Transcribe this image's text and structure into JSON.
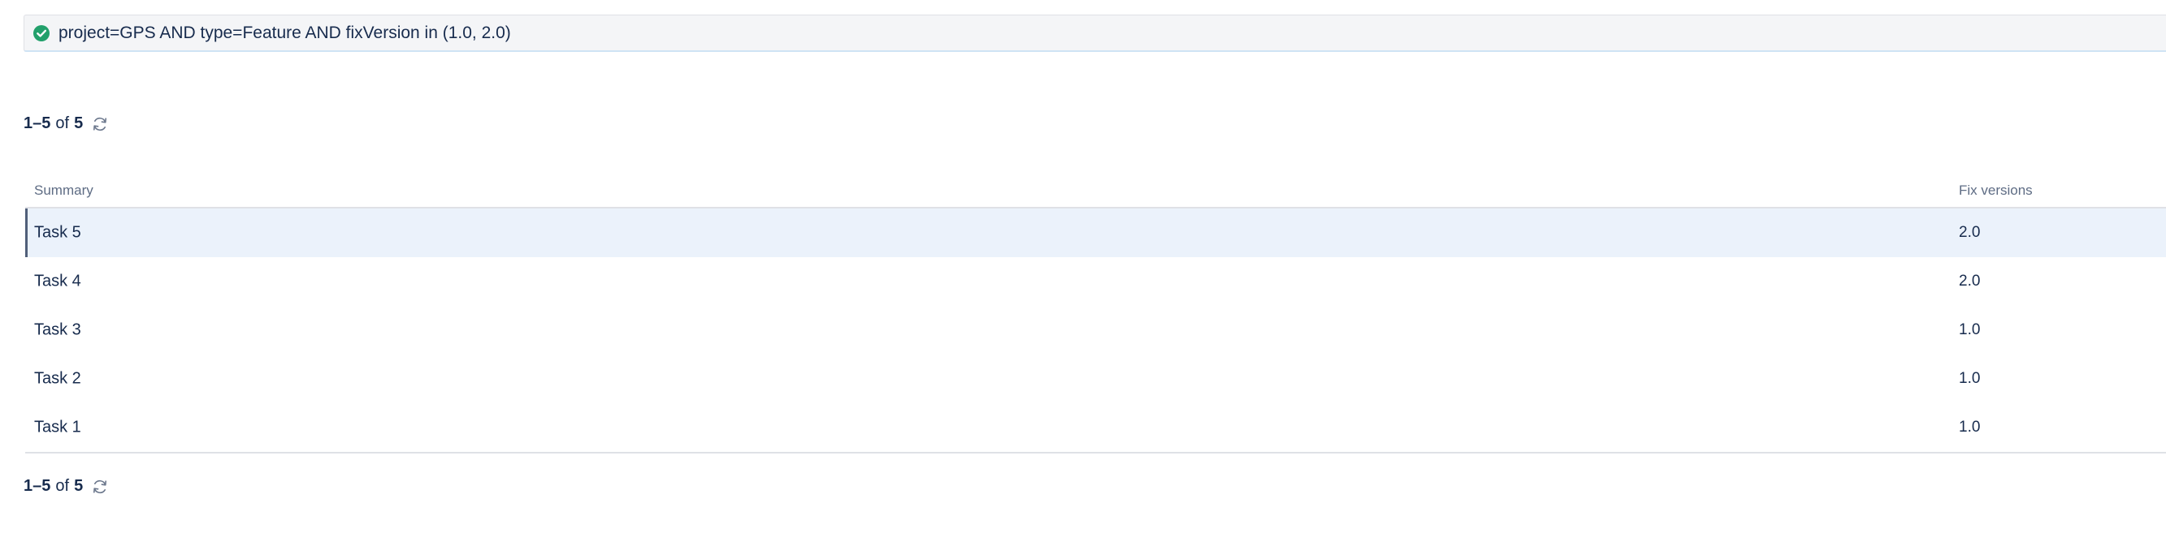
{
  "query": {
    "status_icon": "check-circle-icon",
    "status_color": "#22a06b",
    "text": "project=GPS AND type=Feature AND fixVersion in (1.0, 2.0)"
  },
  "pagination": {
    "range": "1–5",
    "of_label": "of",
    "total": "5",
    "refresh_icon": "refresh-icon"
  },
  "table": {
    "columns": {
      "summary": "Summary",
      "fix_versions": "Fix versions"
    },
    "rows": [
      {
        "summary": "Task 5",
        "fix_versions": "2.0",
        "selected": true
      },
      {
        "summary": "Task 4",
        "fix_versions": "2.0"
      },
      {
        "summary": "Task 3",
        "fix_versions": "1.0"
      },
      {
        "summary": "Task 2",
        "fix_versions": "1.0"
      },
      {
        "summary": "Task 1",
        "fix_versions": "1.0"
      }
    ]
  },
  "colors": {
    "selected_row_bg": "#ebf2fb",
    "text": "#172b4d",
    "header_text": "#5e6c84"
  }
}
